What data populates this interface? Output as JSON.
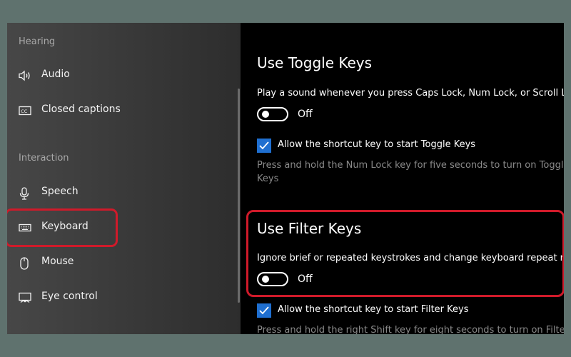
{
  "sidebar": {
    "hearing_label": "Hearing",
    "interaction_label": "Interaction",
    "items": [
      {
        "label": "Audio",
        "icon": "speaker-icon"
      },
      {
        "label": "Closed captions",
        "icon": "closed-captions-icon"
      },
      {
        "label": "Speech",
        "icon": "microphone-icon"
      },
      {
        "label": "Keyboard",
        "icon": "keyboard-icon"
      },
      {
        "label": "Mouse",
        "icon": "mouse-icon"
      },
      {
        "label": "Eye control",
        "icon": "eye-control-icon"
      }
    ],
    "selected": "Keyboard"
  },
  "main": {
    "toggle_keys": {
      "heading": "Use Toggle Keys",
      "description": "Play a sound whenever you press Caps Lock, Num Lock, or Scroll Lock",
      "toggle_state": "Off",
      "checkbox_label": "Allow the shortcut key to start Toggle Keys",
      "checkbox_checked": true,
      "hint": "Press and hold the Num Lock key for five seconds to turn on Toggle Keys"
    },
    "filter_keys": {
      "heading": "Use Filter Keys",
      "description": "Ignore brief or repeated keystrokes and change keyboard repeat rates",
      "toggle_state": "Off",
      "checkbox_label": "Allow the shortcut key to start Filter Keys",
      "checkbox_checked": true,
      "hint": "Press and hold the right Shift key for eight seconds to turn on Filter Keys"
    }
  },
  "colors": {
    "highlight": "#d01a2a",
    "checkbox": "#1f6fd0"
  }
}
